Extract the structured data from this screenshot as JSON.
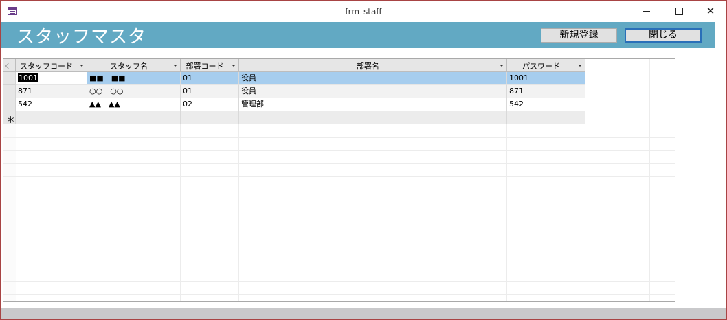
{
  "window": {
    "title": "frm_staff"
  },
  "form": {
    "title": "スタッフマスタ",
    "new_button_label": "新規登録",
    "close_button_label": "閉じる"
  },
  "grid": {
    "columns": [
      "スタッフコード",
      "スタッフ名",
      "部署コード",
      "部署名",
      "パスワード"
    ],
    "rows": [
      [
        "1001",
        "■■　■■",
        "01",
        "役員",
        "1001"
      ],
      [
        "871",
        "○○　○○",
        "01",
        "役員",
        "871"
      ],
      [
        "542",
        "▲▲　▲▲",
        "02",
        "管理部",
        "542"
      ]
    ],
    "new_row_marker": "＊"
  }
}
